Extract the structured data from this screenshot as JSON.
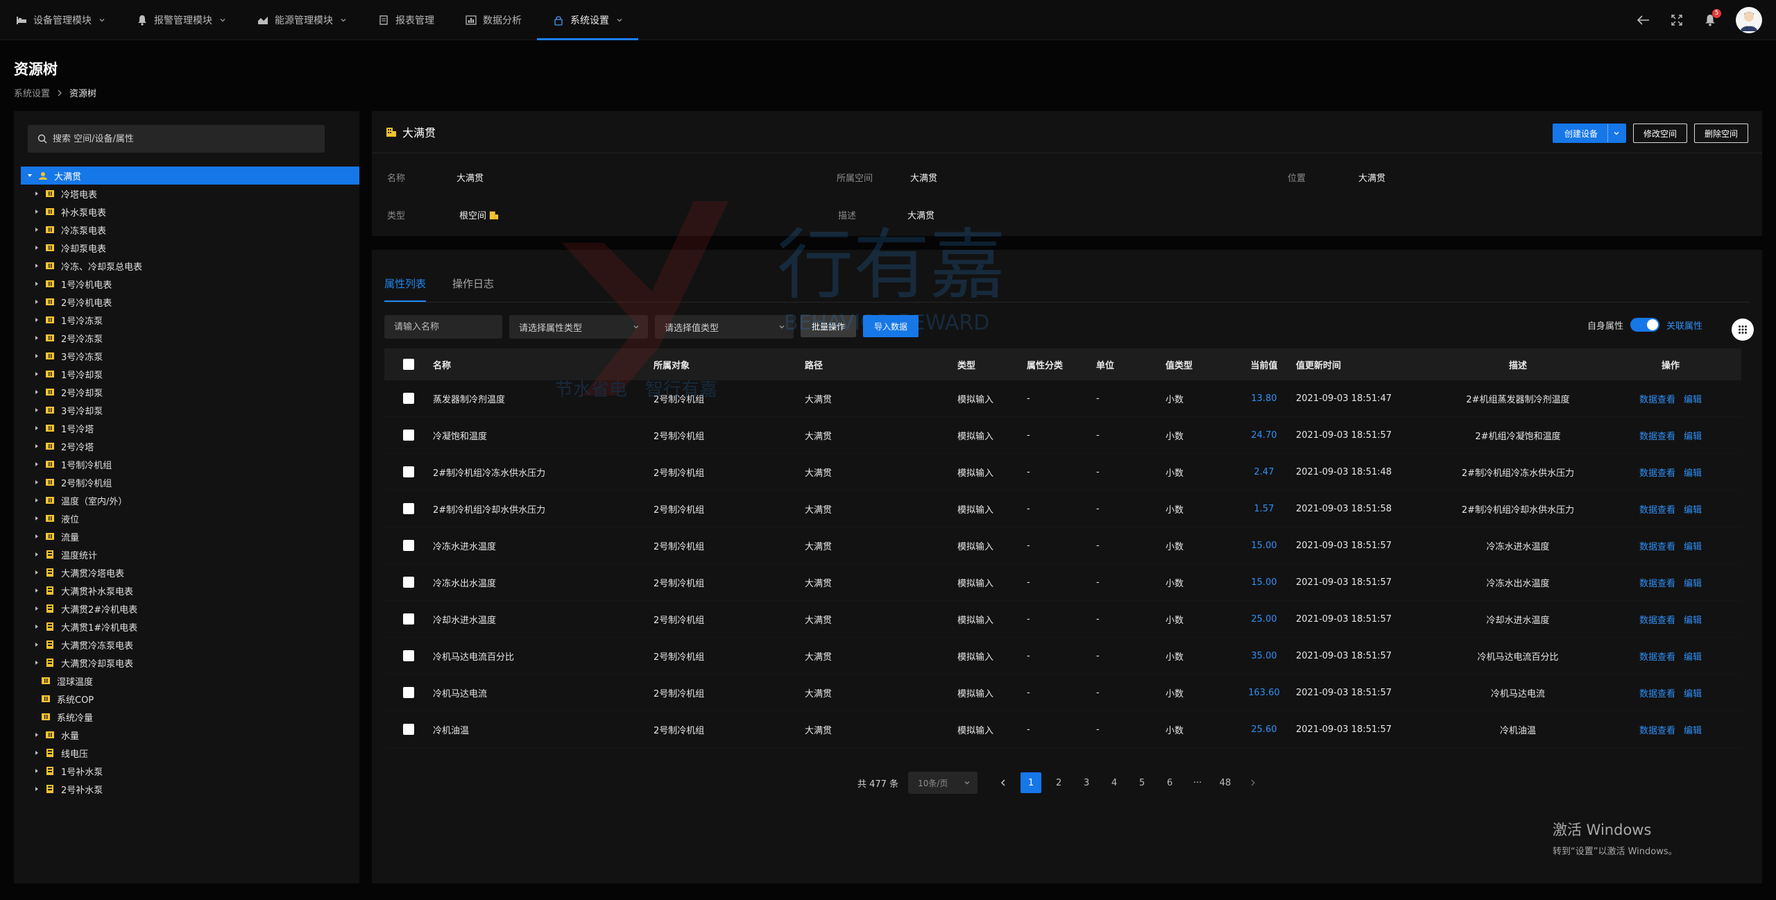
{
  "nav": {
    "items": [
      {
        "label": "设备管理模块",
        "icon": "bed-icon",
        "dropdown": true
      },
      {
        "label": "报警管理模块",
        "icon": "bell-icon",
        "dropdown": true
      },
      {
        "label": "能源管理模块",
        "icon": "chart-icon",
        "dropdown": true
      },
      {
        "label": "报表管理",
        "icon": "report-icon",
        "dropdown": false
      },
      {
        "label": "数据分析",
        "icon": "bar-chart-icon",
        "dropdown": false
      },
      {
        "label": "系统设置",
        "icon": "lock-icon",
        "dropdown": true,
        "active": true
      }
    ],
    "notification_count": "5"
  },
  "header": {
    "title": "资源树",
    "breadcrumb": [
      "系统设置",
      "资源树"
    ]
  },
  "tree": {
    "search_placeholder": "搜索 空间/设备/属性",
    "root": "大满贯",
    "items": [
      "冷塔电表",
      "补水泵电表",
      "冷冻泵电表",
      "冷却泵电表",
      "冷冻、冷却泵总电表",
      "1号冷机电表",
      "2号冷机电表",
      "1号冷冻泵",
      "2号冷冻泵",
      "3号冷冻泵",
      "1号冷却泵",
      "2号冷却泵",
      "3号冷却泵",
      "1号冷塔",
      "2号冷塔",
      "1号制冷机组",
      "2号制冷机组",
      "温度（室内/外）",
      "液位",
      "流量",
      "温度统计",
      "大满贯冷塔电表",
      "大满贯补水泵电表",
      "大满贯2#冷机电表",
      "大满贯1#冷机电表",
      "大满贯冷冻泵电表",
      "大满贯冷却泵电表",
      "湿球温度",
      "系统COP",
      "系统冷量",
      "水量",
      "线电压",
      "1号补水泵",
      "2号补水泵"
    ]
  },
  "detail": {
    "title": "大满贯",
    "buttons": {
      "create": "创建设备",
      "edit": "修改空间",
      "delete": "删除空间"
    },
    "fields": {
      "name_label": "名称",
      "name_value": "大满贯",
      "space_label": "所属空间",
      "space_value": "大满贯",
      "position_label": "位置",
      "position_value": "大满贯",
      "type_label": "类型",
      "type_value": "根空间",
      "desc_label": "描述",
      "desc_value": "大满贯"
    }
  },
  "list": {
    "tabs": [
      "属性列表",
      "操作日志"
    ],
    "filters": {
      "name_placeholder": "请输入名称",
      "attr_type_placeholder": "请选择属性类型",
      "value_type_placeholder": "请选择值类型",
      "batch": "批量操作",
      "import": "导入数据"
    },
    "switch": {
      "left": "自身属性",
      "right": "关联属性"
    },
    "columns": [
      "名称",
      "所属对象",
      "路径",
      "类型",
      "属性分类",
      "单位",
      "值类型",
      "当前值",
      "值更新时间",
      "描述",
      "操作"
    ],
    "rows": [
      {
        "name": "蒸发器制冷剂温度",
        "obj": "2号制冷机组",
        "path": "大满贯",
        "type": "模拟输入",
        "cls": "-",
        "unit": "-",
        "vt": "小数",
        "cur": "13.80",
        "time": "2021-09-03 18:51:47",
        "desc": "2#机组蒸发器制冷剂温度"
      },
      {
        "name": "冷凝饱和温度",
        "obj": "2号制冷机组",
        "path": "大满贯",
        "type": "模拟输入",
        "cls": "-",
        "unit": "-",
        "vt": "小数",
        "cur": "24.70",
        "time": "2021-09-03 18:51:57",
        "desc": "2#机组冷凝饱和温度"
      },
      {
        "name": "2#制冷机组冷冻水供水压力",
        "obj": "2号制冷机组",
        "path": "大满贯",
        "type": "模拟输入",
        "cls": "-",
        "unit": "-",
        "vt": "小数",
        "cur": "2.47",
        "time": "2021-09-03 18:51:48",
        "desc": "2#制冷机组冷冻水供水压力"
      },
      {
        "name": "2#制冷机组冷却水供水压力",
        "obj": "2号制冷机组",
        "path": "大满贯",
        "type": "模拟输入",
        "cls": "-",
        "unit": "-",
        "vt": "小数",
        "cur": "1.57",
        "time": "2021-09-03 18:51:58",
        "desc": "2#制冷机组冷却水供水压力"
      },
      {
        "name": "冷冻水进水温度",
        "obj": "2号制冷机组",
        "path": "大满贯",
        "type": "模拟输入",
        "cls": "-",
        "unit": "-",
        "vt": "小数",
        "cur": "15.00",
        "time": "2021-09-03 18:51:57",
        "desc": "冷冻水进水温度"
      },
      {
        "name": "冷冻水出水温度",
        "obj": "2号制冷机组",
        "path": "大满贯",
        "type": "模拟输入",
        "cls": "-",
        "unit": "-",
        "vt": "小数",
        "cur": "15.00",
        "time": "2021-09-03 18:51:57",
        "desc": "冷冻水出水温度"
      },
      {
        "name": "冷却水进水温度",
        "obj": "2号制冷机组",
        "path": "大满贯",
        "type": "模拟输入",
        "cls": "-",
        "unit": "-",
        "vt": "小数",
        "cur": "25.00",
        "time": "2021-09-03 18:51:57",
        "desc": "冷却水进水温度"
      },
      {
        "name": "冷机马达电流百分比",
        "obj": "2号制冷机组",
        "path": "大满贯",
        "type": "模拟输入",
        "cls": "-",
        "unit": "-",
        "vt": "小数",
        "cur": "35.00",
        "time": "2021-09-03 18:51:57",
        "desc": "冷机马达电流百分比"
      },
      {
        "name": "冷机马达电流",
        "obj": "2号制冷机组",
        "path": "大满贯",
        "type": "模拟输入",
        "cls": "-",
        "unit": "-",
        "vt": "小数",
        "cur": "163.60",
        "time": "2021-09-03 18:51:57",
        "desc": "冷机马达电流"
      },
      {
        "name": "冷机油温",
        "obj": "2号制冷机组",
        "path": "大满贯",
        "type": "模拟输入",
        "cls": "-",
        "unit": "-",
        "vt": "小数",
        "cur": "25.60",
        "time": "2021-09-03 18:51:57",
        "desc": "冷机油温"
      }
    ],
    "ops": {
      "view": "数据查看",
      "edit": "编辑"
    },
    "pager": {
      "total": "共 477 条",
      "size": "10条/页",
      "pages": [
        "1",
        "2",
        "3",
        "4",
        "5",
        "6",
        "···",
        "48"
      ],
      "current": "1"
    }
  },
  "watermark": {
    "brand_cn": "行有嘉",
    "brand_en": "BEHAVIOR REWARD",
    "slogan1": "节水省电",
    "slogan2": "智行有嘉"
  },
  "windows": {
    "line1": "激活 Windows",
    "line2": "转到“设置”以激活 Windows。"
  },
  "colors": {
    "accent": "#1677e8",
    "link": "#2f8ff5",
    "folder": "#f2c230"
  }
}
